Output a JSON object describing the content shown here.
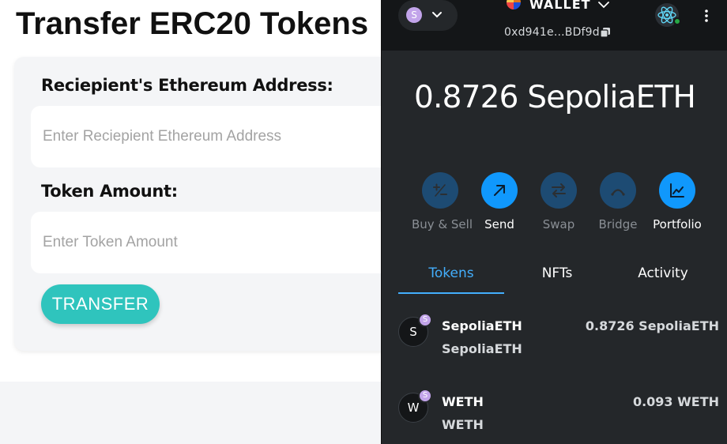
{
  "dapp": {
    "title": "Transfer ERC20 Tokens",
    "form": {
      "recipient_label": "Reciepient's Ethereum Address:",
      "recipient_placeholder": "Enter Reciepient Ethereum Address",
      "recipient_value": "",
      "amount_label": "Token Amount:",
      "amount_placeholder": "Enter Token Amount",
      "amount_value": "",
      "submit_label": "TRANSFER"
    }
  },
  "wallet": {
    "network": {
      "initial": "S",
      "icon": "chevron-down-icon"
    },
    "account": {
      "name": "WALLET",
      "address": "0xd941e...BDf9d",
      "icons": [
        "account-avatar-icon",
        "chevron-down-icon",
        "copy-icon"
      ]
    },
    "connected_site_icon": "react-icon",
    "menu_icon": "kebab-menu-icon",
    "balance": "0.8726 SepoliaETH",
    "actions": [
      {
        "label": "Buy & Sell",
        "icon": "plus-minus-icon",
        "enabled": false
      },
      {
        "label": "Send",
        "icon": "arrow-up-right-icon",
        "enabled": true
      },
      {
        "label": "Swap",
        "icon": "swap-arrows-icon",
        "enabled": false
      },
      {
        "label": "Bridge",
        "icon": "bridge-icon",
        "enabled": false
      },
      {
        "label": "Portfolio",
        "icon": "chart-line-icon",
        "enabled": true
      }
    ],
    "tabs": [
      {
        "label": "Tokens",
        "active": true
      },
      {
        "label": "NFTs",
        "active": false
      },
      {
        "label": "Activity",
        "active": false
      }
    ],
    "tokens": [
      {
        "avatar": "S",
        "badge": "S",
        "name": "SepoliaETH",
        "subtitle": "SepoliaETH",
        "balance": "0.8726 SepoliaETH"
      },
      {
        "avatar": "W",
        "badge": "S",
        "name": "WETH",
        "subtitle": "WETH",
        "balance": "0.093 WETH"
      }
    ]
  },
  "colors": {
    "accent_teal": "#2fc4bd",
    "wallet_bg": "#24272a",
    "wallet_header_bg": "#141618",
    "wallet_primary_blue": "#1098fc",
    "wallet_tab_active": "#43aefc",
    "network_badge": "#c2a4ea",
    "status_green": "#28a745"
  }
}
